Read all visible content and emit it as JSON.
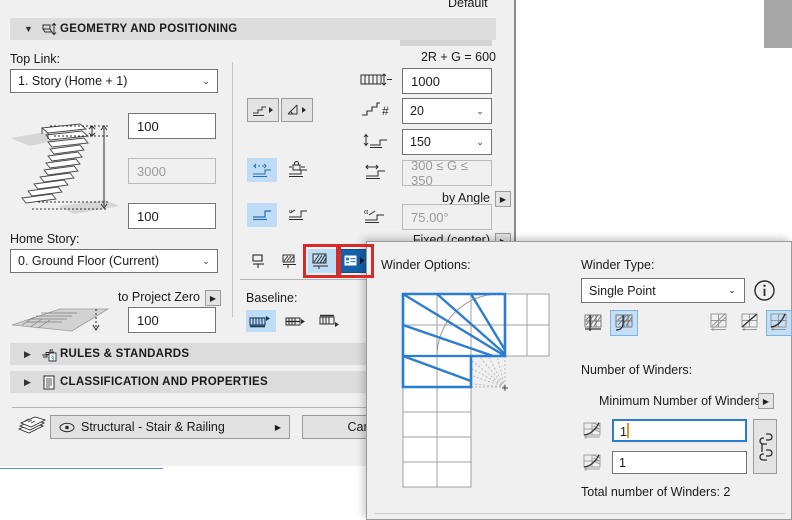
{
  "window": {
    "default_label": "Default"
  },
  "sections": [
    {
      "id": "geometry",
      "title": "GEOMETRY AND POSITIONING",
      "icon": "stair-height-icon",
      "expanded": true
    },
    {
      "id": "rules",
      "title": "RULES & STANDARDS",
      "icon": "rules-standards-icon",
      "expanded": false
    },
    {
      "id": "classification",
      "title": "CLASSIFICATION AND PROPERTIES",
      "icon": "document-icon",
      "expanded": false
    }
  ],
  "geometry": {
    "top_link_label": "Top Link:",
    "top_link_value": "1. Story (Home + 1)",
    "home_story_label": "Home Story:",
    "home_story_value": "0. Ground Floor (Current)",
    "top_offset_value": "100",
    "total_height_value": "3000",
    "bottom_offset_value": "100",
    "to_project_zero_label": "to Project Zero",
    "to_project_zero_value": "100",
    "formula_label": "2R + G = 600",
    "tread_total_value": "1000",
    "risers_count_value": "20",
    "riser_height_value": "150",
    "going_range_value": "300 ≤ G ≤ 350",
    "by_angle_label": "by Angle",
    "angle_value": "75.00°",
    "fixed_center_label": "Fixed (center)",
    "baseline_label": "Baseline:",
    "icons": {
      "stair_structure": "stair-structure-icon",
      "stair_direction": "stair-direction-icon",
      "tread_width_lock": "tread-width-icon",
      "tread_lock": "tread-lock-icon",
      "flight_flat": "flight-flat-icon",
      "flight_angle": "flight-angle-icon",
      "total_tread": "tread-total-icon",
      "riser_number": "riser-count-icon",
      "riser_height": "riser-height-icon",
      "going": "going-icon",
      "angle": "stair-angle-icon",
      "monolith_a": "stair-edge-icon",
      "monolith_b": "stair-landing-icon",
      "winder_preview": "winder-stair-icon",
      "winder_settings": "winder-settings-icon",
      "baseline_start": "baseline-start-icon",
      "baseline_middle": "baseline-middle-icon",
      "baseline_end": "baseline-end-icon",
      "stair_preview": "stair-section-preview",
      "project_zero_preview": "stair-plan-preview"
    }
  },
  "footer": {
    "favorites_icon": "favorites-icon",
    "eye_icon": "eye-icon",
    "layer_value": "Structural - Stair & Railing",
    "cancel_label": "Cancel"
  },
  "winder_dialog": {
    "options_label": "Winder Options:",
    "type_label": "Winder Type:",
    "type_value": "Single Point",
    "info_icon": "info-icon",
    "number_label": "Number of Winders:",
    "minimum_label": "Minimum Number of Winders",
    "winder_count_1": "1",
    "winder_count_2": "1",
    "total_label": "Total number of Winders: 2",
    "link_icon": "link-chain-icon",
    "distribution_icons": [
      {
        "name": "winder-straight-icon",
        "selected": false
      },
      {
        "name": "winder-curved-icon",
        "selected": true
      }
    ],
    "shape_icons": [
      {
        "name": "winder-shape-1-icon",
        "selected": false
      },
      {
        "name": "winder-shape-2-icon",
        "selected": false
      },
      {
        "name": "winder-shape-3-icon",
        "selected": true
      }
    ],
    "preview": {
      "name": "winder-l-shape-preview",
      "accent_color": "#2b7cd3",
      "grid_color": "#a0a0a0",
      "guide_color": "#b8b8b8"
    }
  },
  "annotations": {
    "color": "#d82b27",
    "boxes": [
      {
        "name": "annotation-winder-preview-icon"
      },
      {
        "name": "annotation-winder-settings-icon"
      }
    ]
  }
}
